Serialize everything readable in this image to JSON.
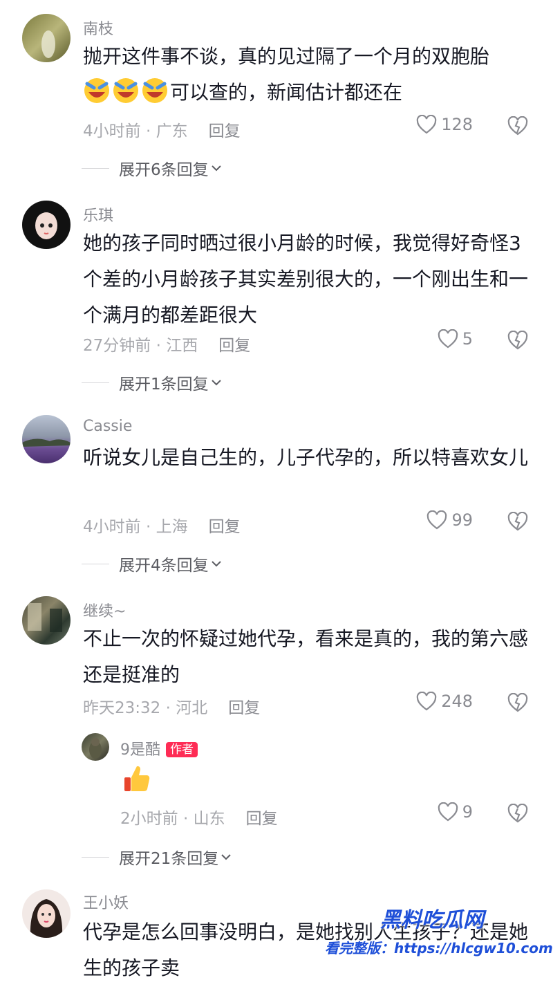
{
  "comments": [
    {
      "username": "南枝",
      "text": "抛开这件事不谈，真的见过隔了一个月的双胞胎",
      "text2": "可以查的，新闻估计都还在",
      "emojis": [
        "grinning-crying-emoji",
        "grinning-crying-emoji",
        "grinning-crying-emoji"
      ],
      "time_loc": "4小时前 · 广东",
      "reply_label": "回复",
      "likes": "128",
      "expand_label": "展开6条回复"
    },
    {
      "username": "乐琪",
      "text": "她的孩子同时晒过很小月龄的时候，我觉得好奇怪3个差的小月龄孩子其实差别很大的，一个刚出生和一个满月的都差距很大",
      "time_loc": "27分钟前 · 江西",
      "reply_label": "回复",
      "likes": "5",
      "expand_label": "展开1条回复"
    },
    {
      "username": "Cassie",
      "text": "听说女儿是自己生的，儿子代孕的，所以特喜欢女儿",
      "time_loc": "4小时前 · 上海",
      "reply_label": "回复",
      "likes": "99",
      "expand_label": "展开4条回复"
    },
    {
      "username": "继续~",
      "text": "不止一次的怀疑过她代孕，看来是真的，我的第六感还是挺准的",
      "time_loc": "昨天23:32 · 河北",
      "reply_label": "回复",
      "likes": "248",
      "reply": {
        "username": "9是酷",
        "author_tag": "作者",
        "emoji": "thumbs-up-emoji",
        "time_loc": "2小时前 · 山东",
        "reply_label": "回复",
        "likes": "9"
      },
      "expand_label": "展开21条回复"
    },
    {
      "username": "王小妖",
      "text": "代孕是怎么回事没明白，是她找别人生孩子？还是她生的孩子卖"
    }
  ],
  "watermark": {
    "line1": "黑料吃瓜网",
    "line2": "看完整版：https://hlcgw10.com"
  },
  "colors": {
    "author_tag": "#fe2c55",
    "watermark": "#1e4fd8"
  }
}
